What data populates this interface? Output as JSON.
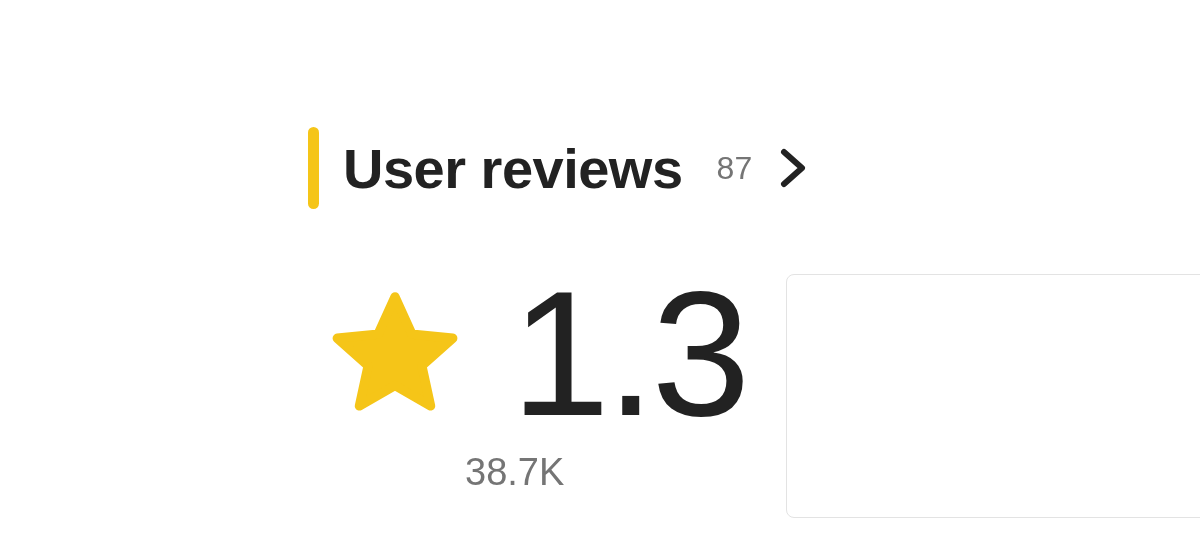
{
  "section": {
    "title": "User reviews",
    "review_count": "87"
  },
  "rating": {
    "score": "1.3",
    "ratings_count": "38.7K"
  }
}
